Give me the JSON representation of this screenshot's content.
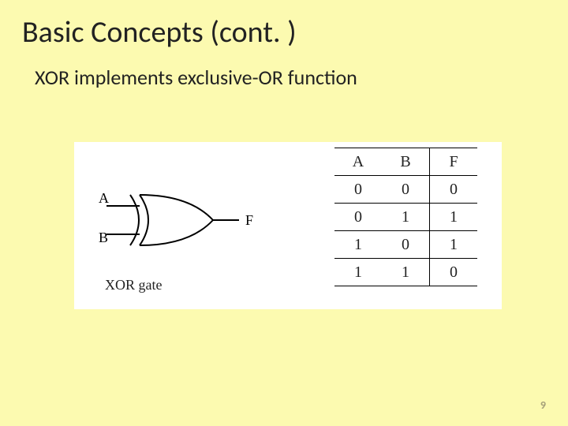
{
  "title": "Basic Concepts (cont. )",
  "subtitle": "XOR implements exclusive-OR function",
  "gate": {
    "input_a": "A",
    "input_b": "B",
    "output": "F",
    "caption": "XOR gate"
  },
  "truth_table": {
    "headers": [
      "A",
      "B",
      "F"
    ],
    "rows": [
      [
        "0",
        "0",
        "0"
      ],
      [
        "0",
        "1",
        "1"
      ],
      [
        "1",
        "0",
        "1"
      ],
      [
        "1",
        "1",
        "0"
      ]
    ]
  },
  "page_number": "9"
}
